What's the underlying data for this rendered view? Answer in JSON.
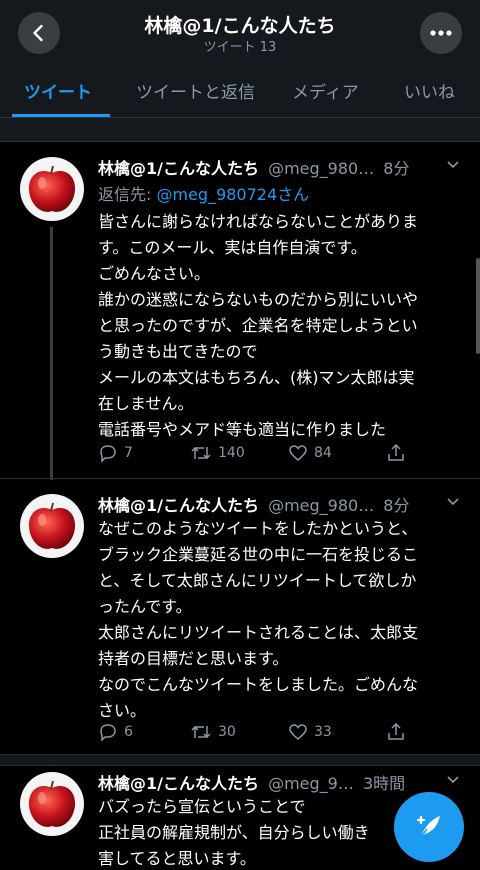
{
  "header": {
    "title": "林檎@1/こんな人たち",
    "subtitle": "ツイート 13",
    "back_icon": "chevron-left-icon",
    "more_icon": "more-icon"
  },
  "tabs": [
    {
      "label": "ツイート",
      "active": true
    },
    {
      "label": "ツイートと返信",
      "active": false
    },
    {
      "label": "メディア",
      "active": false
    },
    {
      "label": "いいね",
      "active": false
    }
  ],
  "tweets": [
    {
      "name": "林檎@1/こんな人たち",
      "handle": "@meg_980…",
      "time": "8分",
      "reply_prefix": "返信先: ",
      "reply_to": "@meg_980724さん",
      "lines": [
        "皆さんに謝らなければならないことがありま",
        "す。このメール、実は自作自演です。",
        "ごめんなさい。",
        "誰かの迷惑にならないものだから別にいいや",
        "と思ったのですが、企業名を特定しようとい",
        "う動きも出てきたので",
        "メールの本文はもちろん、(株)マン太郎は実",
        "在しません。",
        "電話番号やメアド等も適当に作りました"
      ],
      "replies": "7",
      "retweets": "140",
      "likes": "84"
    },
    {
      "name": "林檎@1/こんな人たち",
      "handle": "@meg_980…",
      "time": "8分",
      "lines": [
        "なぜこのようなツイートをしたかというと、",
        "ブラック企業蔓延る世の中に一石を投じるこ",
        "と、そして太郎さんにリツイートして欲しか",
        "ったんです。",
        "太郎さんにリツイートされることは、太郎支",
        "持者の目標だと思います。",
        "なのでこんなツイートをしました。ごめんな",
        "さい。"
      ],
      "replies": "6",
      "retweets": "30",
      "likes": "33"
    },
    {
      "name": "林檎@1/こんな人たち",
      "handle": "@meg_9…",
      "time": "3時間",
      "lines": [
        "バズったら宣伝ということで",
        "正社員の解雇規制が、自分らしい働き",
        "害してると思います。"
      ]
    }
  ],
  "colors": {
    "accent": "#1d9bf0",
    "background": "#000000",
    "header_bg": "#15181c",
    "muted": "#8b98a5"
  },
  "fab_icon": "compose-tweet-icon"
}
